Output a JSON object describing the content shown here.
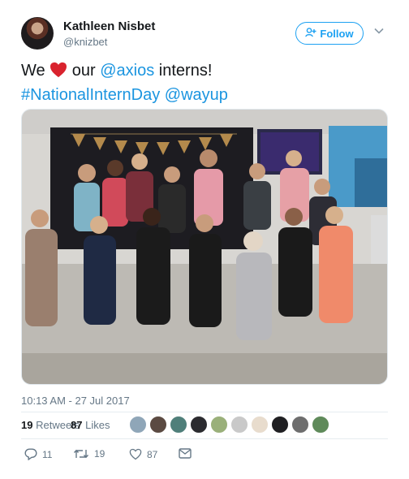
{
  "author": {
    "name": "Kathleen Nisbet",
    "handle": "@knizbet"
  },
  "follow_button": {
    "label": "Follow",
    "icon": "add-user-icon"
  },
  "menu": {
    "icon": "chevron-down-icon"
  },
  "tweet": {
    "text_we": "We",
    "text_our": "our",
    "mention_axios": "@axios",
    "text_interns": "interns!",
    "hashtag": "#NationalInternDay",
    "mention_wayup": "@wayup",
    "heart_color": "#e0245e"
  },
  "photo": {
    "icon": "group-photo"
  },
  "timestamp": "10:13 AM - 27 Jul 2017",
  "stats": {
    "retweets_count": "19",
    "retweets_label": "Retweets",
    "likes_count": "87",
    "likes_label": "Likes",
    "liker_avatar_count": 10
  },
  "actions": {
    "reply_count": "11",
    "retweet_count": "19",
    "like_count": "87"
  },
  "colors": {
    "accent": "#1da1f2",
    "link": "#1b95e0",
    "muted": "#657786",
    "text": "#14171a"
  }
}
